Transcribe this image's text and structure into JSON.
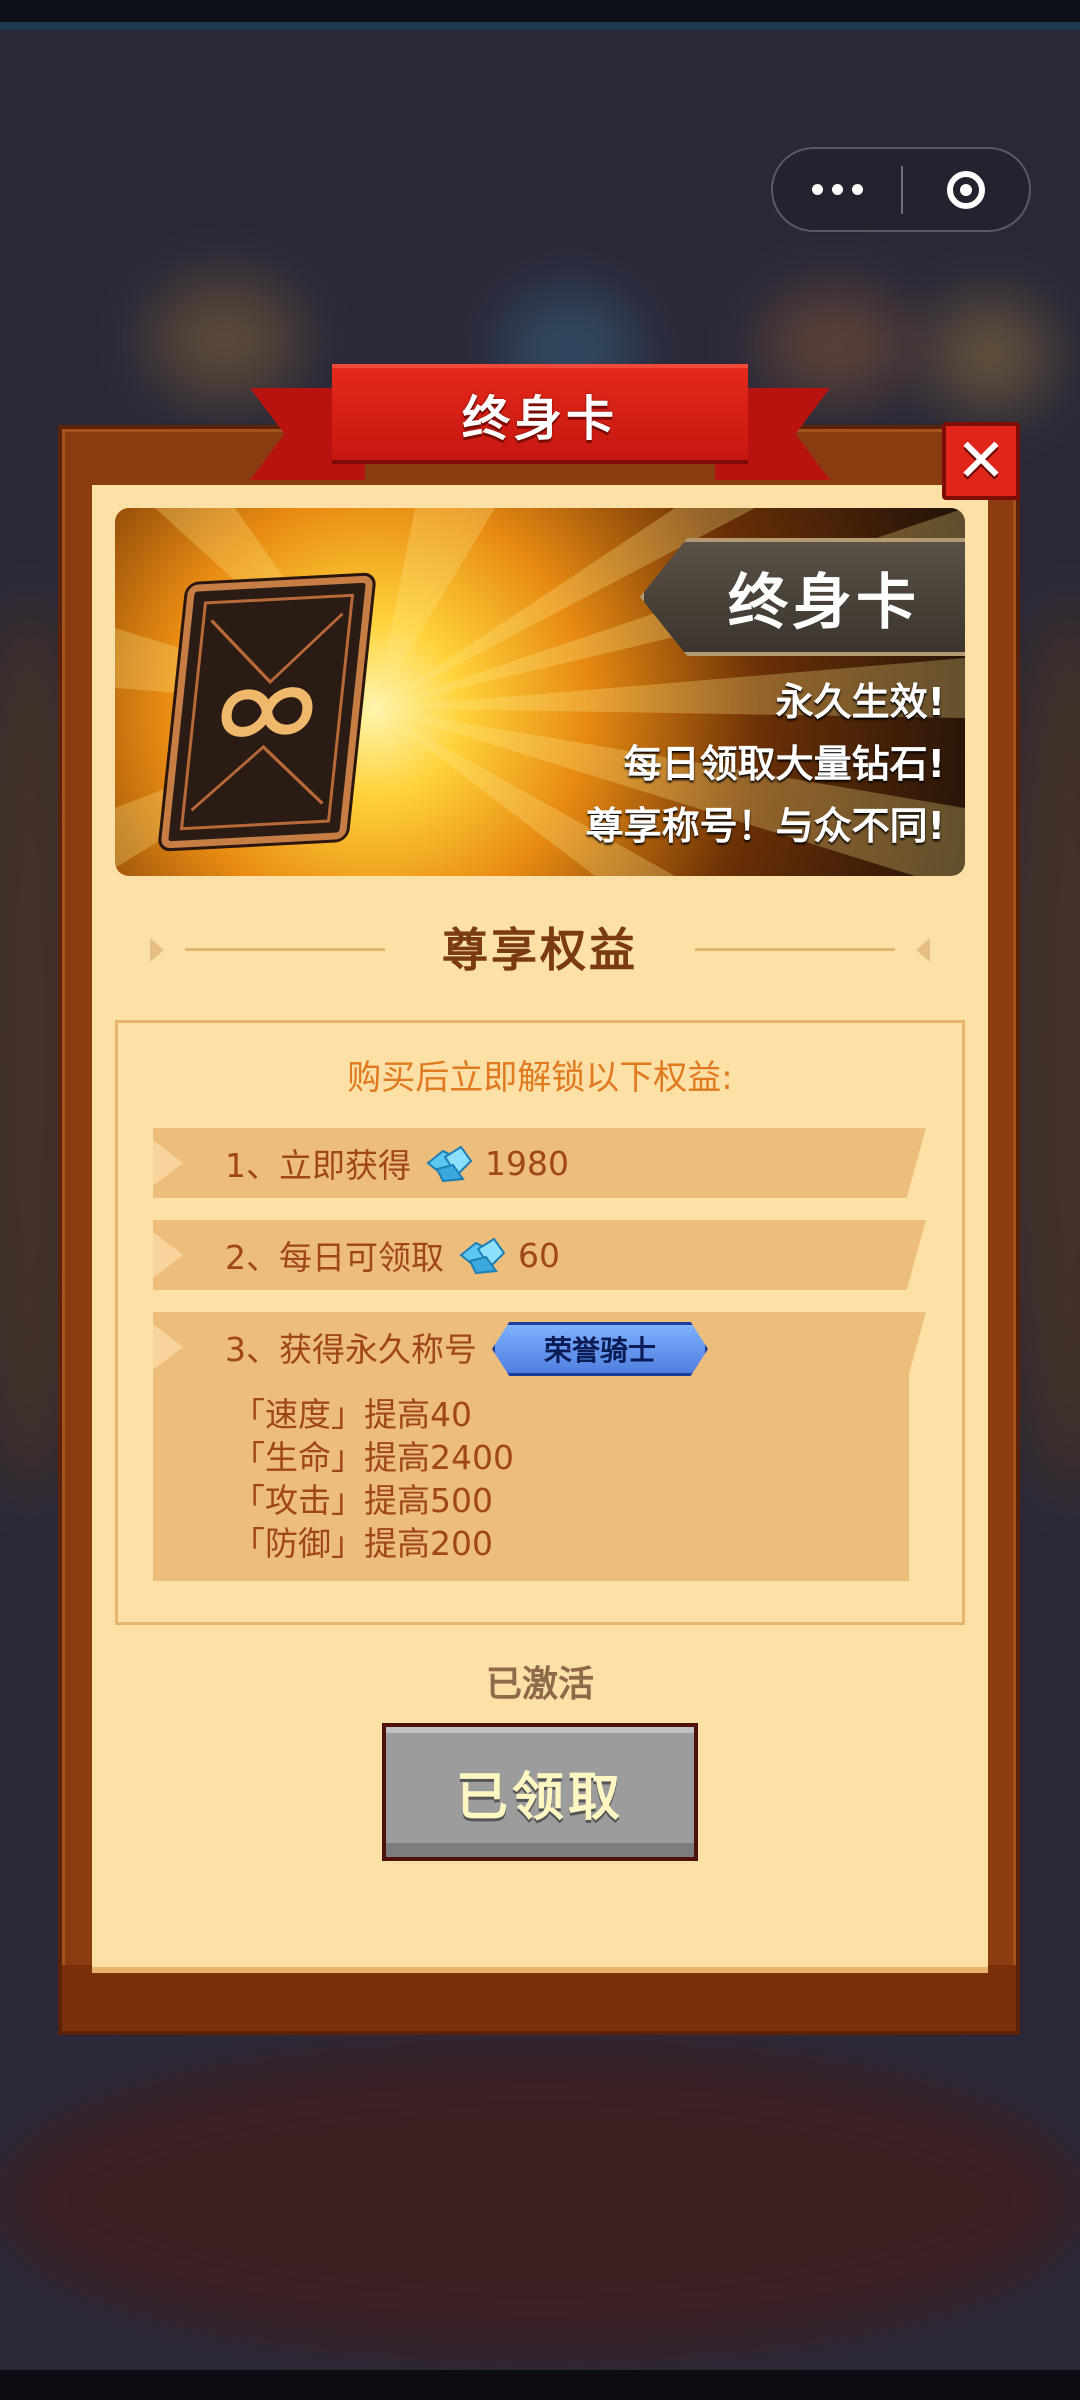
{
  "modal": {
    "title": "终身卡",
    "close_glyph": "✕"
  },
  "banner": {
    "plate_title": "终身卡",
    "lines": [
      "永久生效!",
      "每日领取大量钻石!",
      "尊享称号！与众不同!"
    ]
  },
  "section": {
    "title": "尊享权益"
  },
  "benefits": {
    "intro": "购买后立即解锁以下权益:",
    "item1": {
      "label": "1、立即获得",
      "amount": "1980"
    },
    "item2": {
      "label": "2、每日可领取",
      "amount": "60"
    },
    "item3": {
      "label": "3、获得永久称号",
      "badge": "荣誉骑士",
      "stats": [
        "「速度」提高40",
        "「生命」提高2400",
        "「攻击」提高500",
        "「防御」提高200"
      ]
    }
  },
  "status_text": "已激活",
  "claim_button": "已领取",
  "colors": {
    "ribbon": "#d21e14",
    "paper": "#fde0a6",
    "frame": "#8a3c10",
    "row": "#edbd7c",
    "badge": "#5f8ff0",
    "button_disabled": "#9c9c9c"
  },
  "icons": [
    "more-icon",
    "target-icon",
    "close-icon",
    "diamond-icon",
    "lifetime-card-icon"
  ]
}
